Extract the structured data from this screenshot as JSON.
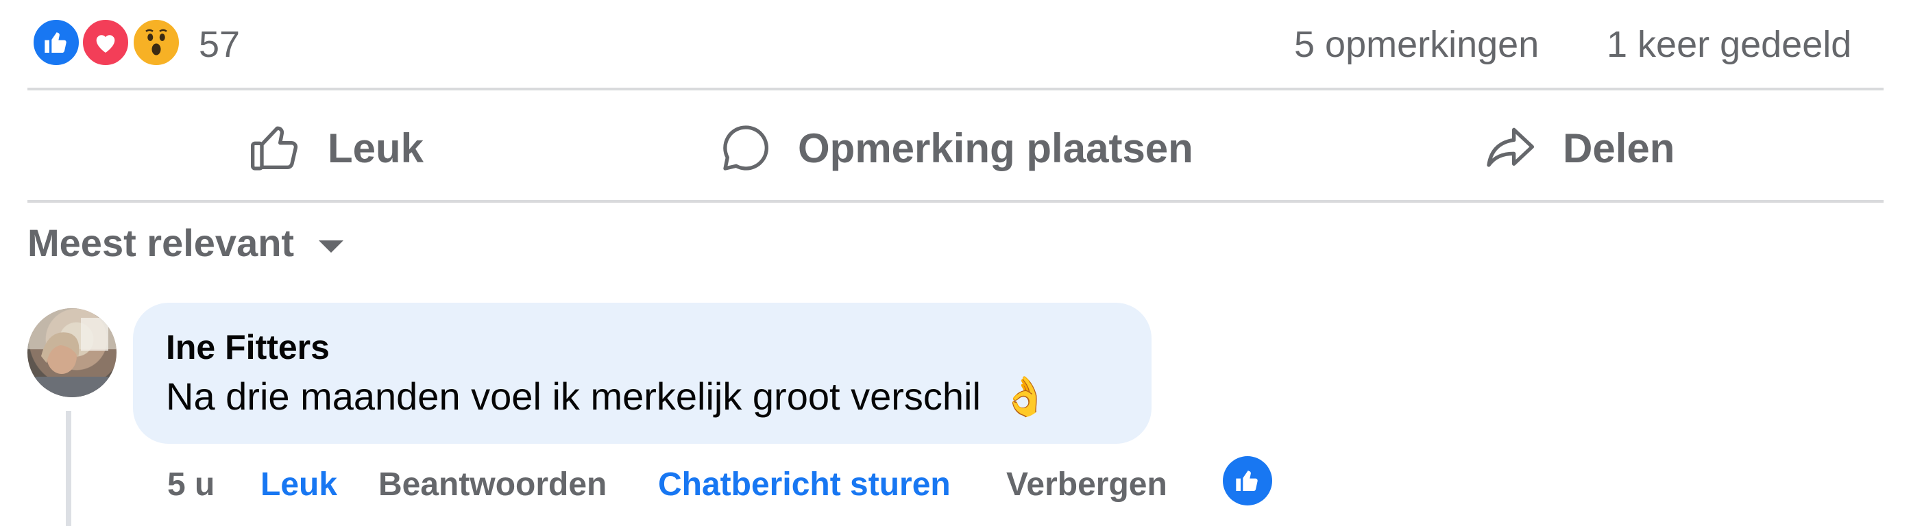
{
  "reactions": {
    "types": [
      "like",
      "love",
      "wow"
    ],
    "count": "57"
  },
  "summary": {
    "comments": "5 opmerkingen",
    "shares": "1 keer gedeeld"
  },
  "actions": {
    "like_label": "Leuk",
    "comment_label": "Opmerking plaatsen",
    "share_label": "Delen"
  },
  "sort": {
    "label": "Meest relevant"
  },
  "comment": {
    "author": "Ine Fitters",
    "text": "Na drie maanden voel ik merkelijk groot verschil",
    "emoji": "👌",
    "time": "5 u",
    "like_label": "Leuk",
    "reply_label": "Beantwoorden",
    "message_label": "Chatbericht sturen",
    "hide_label": "Verbergen",
    "reactions": [
      "like"
    ]
  },
  "colors": {
    "accent": "#1877f2",
    "love": "#f33e58",
    "wow": "#f7b125",
    "bubble": "#e8f1fc",
    "divider": "#d9dadc",
    "secondary_text": "#65676b"
  }
}
